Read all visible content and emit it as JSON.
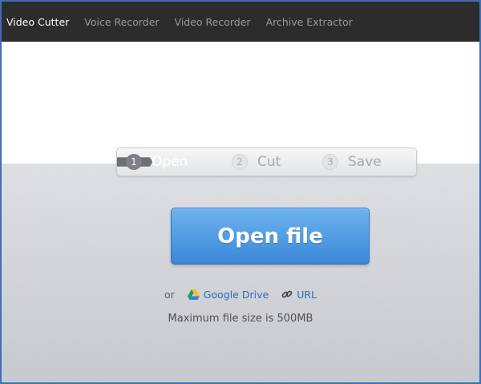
{
  "nav": {
    "items": [
      {
        "label": "Video Cutter",
        "active": true
      },
      {
        "label": "Voice Recorder",
        "active": false
      },
      {
        "label": "Video Recorder",
        "active": false
      },
      {
        "label": "Archive Extractor",
        "active": false
      }
    ]
  },
  "steps": [
    {
      "num": "1",
      "label": "Open",
      "state": "active"
    },
    {
      "num": "2",
      "label": "Cut",
      "state": "inactive"
    },
    {
      "num": "3",
      "label": "Save",
      "state": "inactive"
    }
  ],
  "open_button": {
    "label": "Open file"
  },
  "alternatives": {
    "or_text": "or",
    "google_drive": {
      "label": "Google Drive",
      "icon": "google-drive-icon"
    },
    "url": {
      "label": "URL",
      "icon": "link-icon"
    }
  },
  "max_size_text": "Maximum file size is 500MB",
  "colors": {
    "nav_bg": "#2c2c2c",
    "accent_blue": "#3b88d8",
    "link_blue": "#2f6db8",
    "active_step": "#6c7076",
    "frame_border": "#3f6fb8"
  }
}
